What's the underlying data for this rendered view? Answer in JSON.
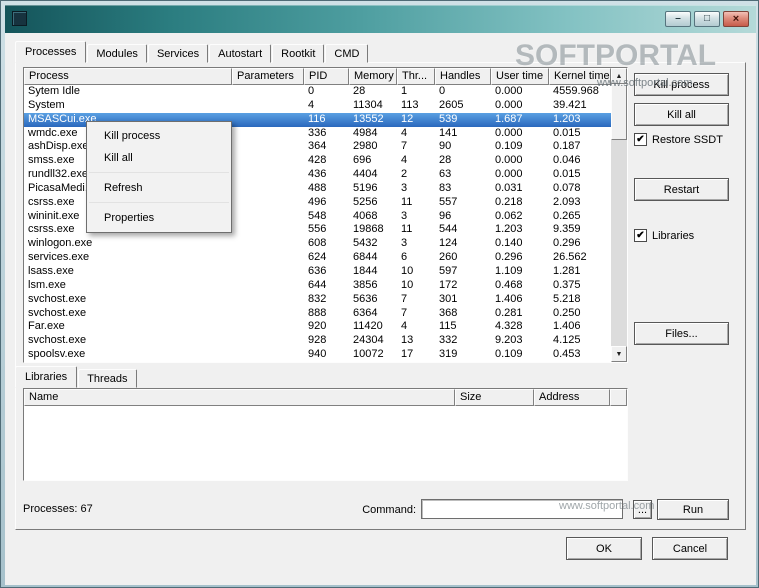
{
  "tabs": [
    "Processes",
    "Modules",
    "Services",
    "Autostart",
    "Rootkit",
    "CMD"
  ],
  "active_tab": "Processes",
  "icons": {
    "minimize": "–",
    "maximize": "□",
    "close": "×",
    "check": "✔",
    "scroll_up": "▲",
    "scroll_down": "▼"
  },
  "process_table": {
    "columns": [
      "Process",
      "Parameters",
      "PID",
      "Memory",
      "Thr...",
      "Handles",
      "User time",
      "Kernel time"
    ],
    "selected_index": 2,
    "rows": [
      [
        "Sytem Idle",
        "",
        "0",
        "28",
        "1",
        "0",
        "0.000",
        "4559.968"
      ],
      [
        "System",
        "",
        "4",
        "11304",
        "113",
        "2605",
        "0.000",
        "39.421"
      ],
      [
        "MSASCui.exe",
        "",
        "116",
        "13552",
        "12",
        "539",
        "1.687",
        "1.203"
      ],
      [
        "wmdc.exe",
        "",
        "336",
        "4984",
        "4",
        "141",
        "0.000",
        "0.015"
      ],
      [
        "ashDisp.exe",
        "",
        "364",
        "2980",
        "7",
        "90",
        "0.109",
        "0.187"
      ],
      [
        "smss.exe",
        "",
        "428",
        "696",
        "4",
        "28",
        "0.000",
        "0.046"
      ],
      [
        "rundll32.exe",
        "",
        "436",
        "4404",
        "2",
        "63",
        "0.000",
        "0.015"
      ],
      [
        "PicasaMedi...",
        "",
        "488",
        "5196",
        "3",
        "83",
        "0.031",
        "0.078"
      ],
      [
        "csrss.exe",
        "",
        "496",
        "5256",
        "11",
        "557",
        "0.218",
        "2.093"
      ],
      [
        "wininit.exe",
        "",
        "548",
        "4068",
        "3",
        "96",
        "0.062",
        "0.265"
      ],
      [
        "csrss.exe",
        "",
        "556",
        "19868",
        "11",
        "544",
        "1.203",
        "9.359"
      ],
      [
        "winlogon.exe",
        "",
        "608",
        "5432",
        "3",
        "124",
        "0.140",
        "0.296"
      ],
      [
        "services.exe",
        "",
        "624",
        "6844",
        "6",
        "260",
        "0.296",
        "26.562"
      ],
      [
        "lsass.exe",
        "",
        "636",
        "1844",
        "10",
        "597",
        "1.109",
        "1.281"
      ],
      [
        "lsm.exe",
        "",
        "644",
        "3856",
        "10",
        "172",
        "0.468",
        "0.375"
      ],
      [
        "svchost.exe",
        "",
        "832",
        "5636",
        "7",
        "301",
        "1.406",
        "5.218"
      ],
      [
        "svchost.exe",
        "",
        "888",
        "6364",
        "7",
        "368",
        "0.281",
        "0.250"
      ],
      [
        "Far.exe",
        "",
        "920",
        "11420",
        "4",
        "115",
        "4.328",
        "1.406"
      ],
      [
        "svchost.exe",
        "",
        "928",
        "24304",
        "13",
        "332",
        "9.203",
        "4.125"
      ],
      [
        "spoolsv.exe",
        "",
        "940",
        "10072",
        "17",
        "319",
        "0.109",
        "0.453"
      ]
    ]
  },
  "context_menu": {
    "items": [
      "Kill process",
      "Kill all",
      "-",
      "Refresh",
      "-",
      "Properties"
    ]
  },
  "side_panel": {
    "kill_process": "Kill process",
    "kill_all": "Kill all",
    "restore_ssdt": "Restore SSDT",
    "restart": "Restart",
    "libraries": "Libraries",
    "files": "Files..."
  },
  "bottom_tabs": [
    "Libraries",
    "Threads"
  ],
  "active_bottom_tab": "Libraries",
  "library_table": {
    "columns": [
      "Name",
      "Size",
      "Address",
      ""
    ]
  },
  "status": {
    "processes_label": "Processes: 67",
    "command_label": "Command:",
    "command_value": "",
    "browse_label": "...",
    "run_label": "Run"
  },
  "footer": {
    "ok_label": "OK",
    "cancel_label": "Cancel"
  },
  "watermark": {
    "brand": "SOFTPORTAL",
    "url": "www.softportal.com"
  }
}
